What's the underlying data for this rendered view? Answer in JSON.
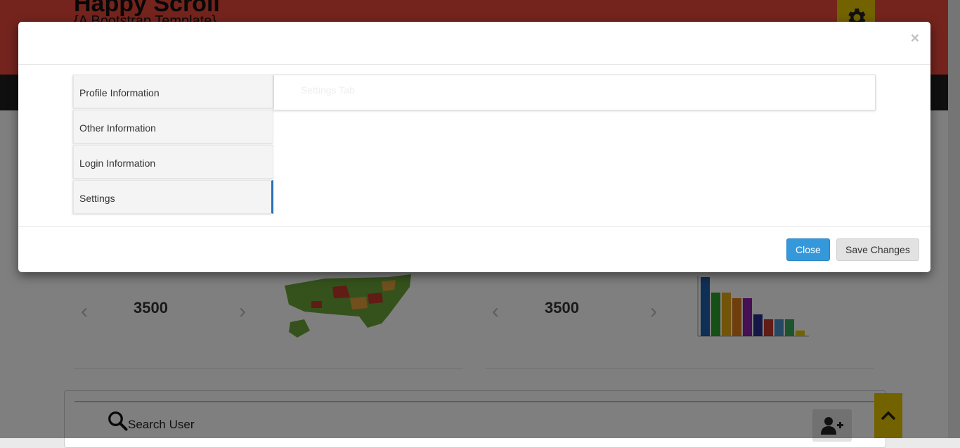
{
  "header": {
    "brand_title": "Happy Scroll",
    "brand_subtitle": "{A Bootstrap Template}",
    "settings_icon": "gear-icon"
  },
  "dashboard": {
    "cards": [
      {
        "value": "3500",
        "graphic": "us-map"
      },
      {
        "value": "3500",
        "graphic": "bar-chart"
      }
    ],
    "user_panel": {
      "search_label": "Search User",
      "search_icon": "search-icon",
      "add_user_icon": "add-user-icon"
    },
    "scroll_top_icon": "chevron-up-icon"
  },
  "modal": {
    "close_glyph": "×",
    "tabs": [
      {
        "label": "Profile Information",
        "active": false
      },
      {
        "label": "Other Information",
        "active": false
      },
      {
        "label": "Login Information",
        "active": false
      },
      {
        "label": "Settings",
        "active": true
      }
    ],
    "content_title": "Settings Tab",
    "footer": {
      "close_label": "Close",
      "save_label": "Save Changes"
    },
    "colors": {
      "primary": "#3498db",
      "active_tab_border": "#2a6fb8"
    }
  }
}
